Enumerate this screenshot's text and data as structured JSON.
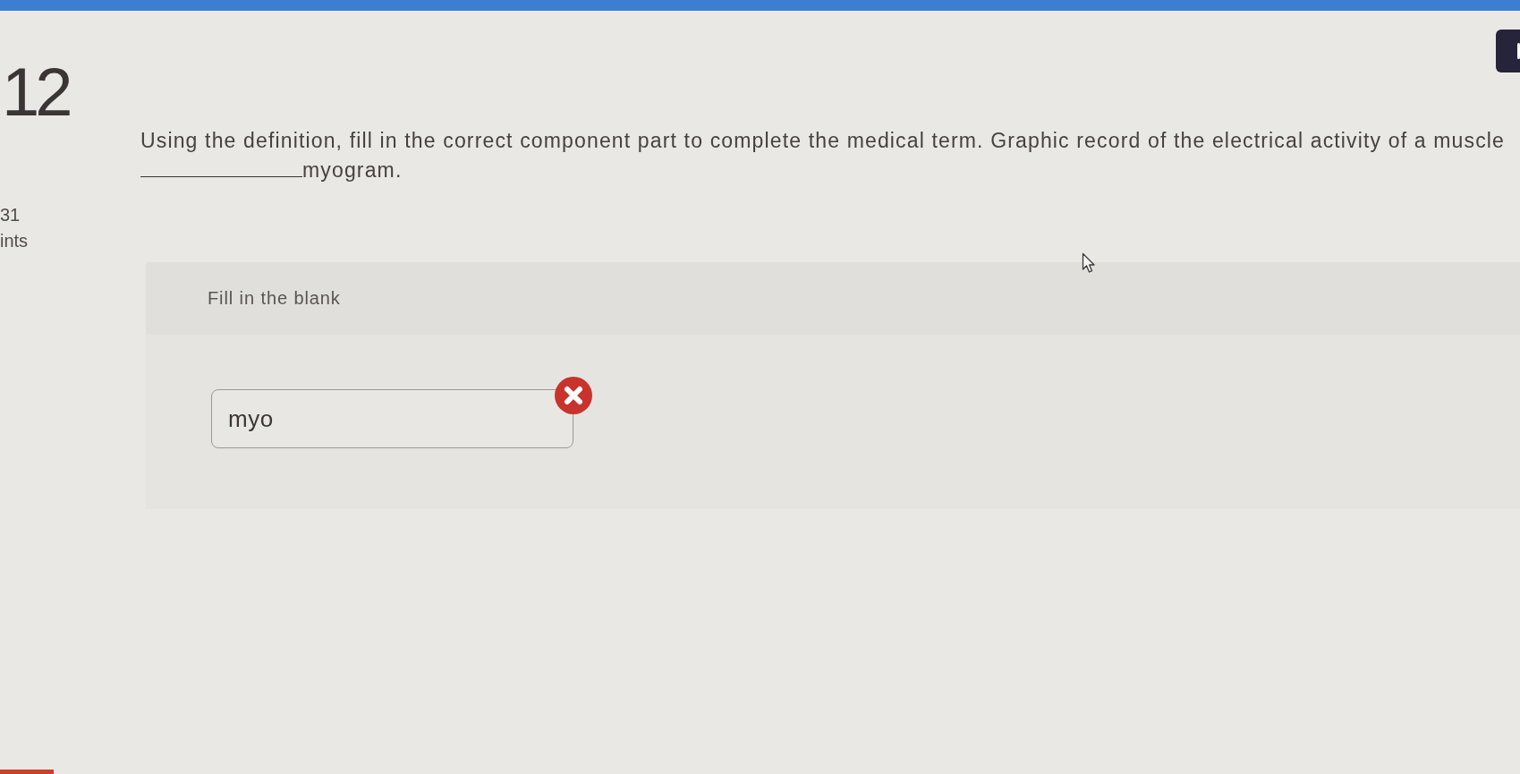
{
  "question": {
    "number": "12",
    "points_value": "31",
    "points_label": "ints",
    "prompt": "Using the definition, fill in the correct component part to complete the medical term. Graphic record of the electrical activity of a muscle",
    "blank_suffix": "myogram."
  },
  "answer_panel": {
    "heading": "Fill in the blank",
    "field": {
      "value": "myo",
      "correct": false
    }
  }
}
